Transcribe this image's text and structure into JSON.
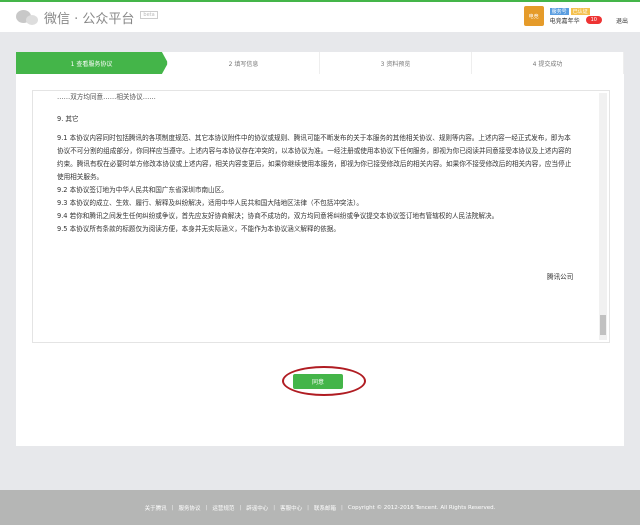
{
  "header": {
    "logo_text": "微信 · 公众平台",
    "beta": "beta",
    "badge_type": "服务号",
    "badge_verified": "已认证",
    "account_name": "电竞嘉年华",
    "notification_count": "10",
    "logout": "退出",
    "avatar_text": "电竞"
  },
  "steps": [
    "1 查看服务协议",
    "2 填写信息",
    "3 资料预览",
    "4 提交成功"
  ],
  "agreement": {
    "cut_line": "……双方均同意……相关协议……",
    "heading": "9. 其它",
    "paragraphs": [
      "9.1 本协议内容同时包括腾讯的各项制度规范、其它本协议附件中的协议或规则、腾讯可能不断发布的关于本服务的其他相关协议、规则等内容。上述内容一经正式发布，即为本协议不可分割的组成部分，你同样应当遵守。上述内容与本协议存在冲突的，以本协议为准。一经注册或使用本协议下任何服务，即视为你已阅读并同意接受本协议及上述内容的约束。腾讯有权在必要时单方修改本协议或上述内容，相关内容变更后，如果你继续使用本服务，即视为你已接受修改后的相关内容。如果你不接受修改后的相关内容，应当停止使用相关服务。",
      "9.2 本协议签订地为中华人民共和国广东省深圳市南山区。",
      "9.3 本协议的成立、生效、履行、解释及纠纷解决，适用中华人民共和国大陆地区法律（不包括冲突法）。",
      "9.4 若你和腾讯之间发生任何纠纷或争议，首先应友好协商解决；协商不成功的，双方均同意将纠纷或争议提交本协议签订地有管辖权的人民法院解决。",
      "9.5 本协议所有条款的标题仅为阅读方便，本身并无实际涵义，不能作为本协议涵义解释的依据。"
    ],
    "signature": "腾讯公司"
  },
  "agree_button": "同意",
  "footer": {
    "links": [
      "关于腾讯",
      "服务协议",
      "运营规范",
      "辟谣中心",
      "客服中心",
      "联系邮箱"
    ],
    "copyright": "Copyright © 2012-2016 Tencent. All Rights Reserved."
  }
}
